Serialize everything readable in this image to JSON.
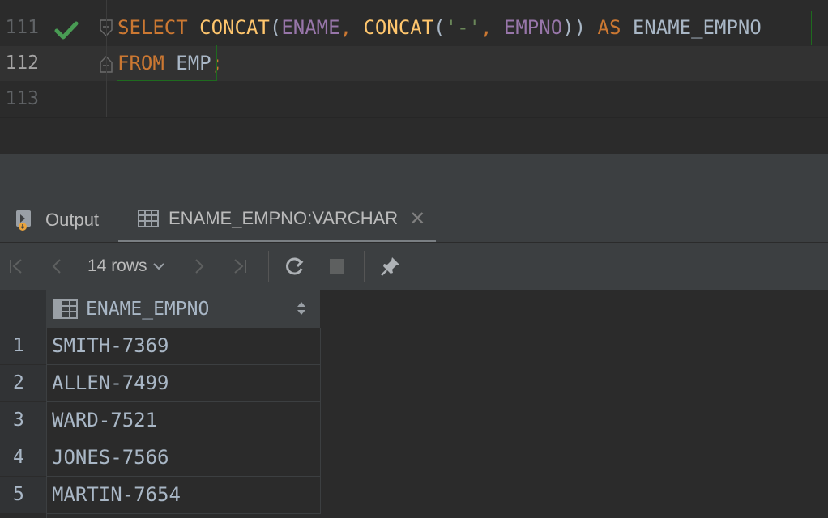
{
  "editor": {
    "lines": [
      {
        "number": "111",
        "status_icon": "check-icon",
        "fold_icon": "fold-start-icon"
      },
      {
        "number": "112",
        "fold_icon": "fold-end-icon"
      },
      {
        "number": "113"
      }
    ],
    "code": {
      "line1": {
        "select": "SELECT",
        "concat1": "CONCAT",
        "open1": "(",
        "ename": "ENAME",
        "comma1": ", ",
        "concat2": "CONCAT",
        "open2": "(",
        "str": "'-'",
        "comma2": ", ",
        "empno": "EMPNO",
        "close": "))",
        "as": "AS",
        "alias": "ENAME_EMPNO"
      },
      "line2": {
        "from": "FROM",
        "table": "EMP",
        "semi": ";"
      }
    }
  },
  "tool_window": {
    "tabs": [
      {
        "label": "Output",
        "icon": "output-console-icon"
      },
      {
        "label": "ENAME_EMPNO:VARCHAR",
        "icon": "table-grid-icon",
        "close_icon": "close-icon",
        "active": true
      }
    ],
    "toolbar": {
      "first_page_icon": "first-page-icon",
      "prev_page_icon": "prev-page-icon",
      "rows_label": "14 rows",
      "rows_dropdown_icon": "chevron-down-icon",
      "next_page_icon": "next-page-icon",
      "last_page_icon": "last-page-icon",
      "refresh_icon": "refresh-icon",
      "stop_icon": "stop-icon",
      "pin_icon": "pin-icon"
    }
  },
  "grid": {
    "columns": [
      {
        "name": "ENAME_EMPNO",
        "icon": "column-icon",
        "sort_icon": "sort-icon"
      }
    ],
    "rows": [
      {
        "num": "1",
        "value": "SMITH-7369"
      },
      {
        "num": "2",
        "value": "ALLEN-7499"
      },
      {
        "num": "3",
        "value": "WARD-7521"
      },
      {
        "num": "4",
        "value": "JONES-7566"
      },
      {
        "num": "5",
        "value": "MARTIN-7654"
      }
    ]
  },
  "colors": {
    "keyword": "#cc7832",
    "function": "#ffc66d",
    "column": "#9876aa",
    "string": "#6a8759",
    "text": "#a9b7c6",
    "check": "#499c54"
  }
}
